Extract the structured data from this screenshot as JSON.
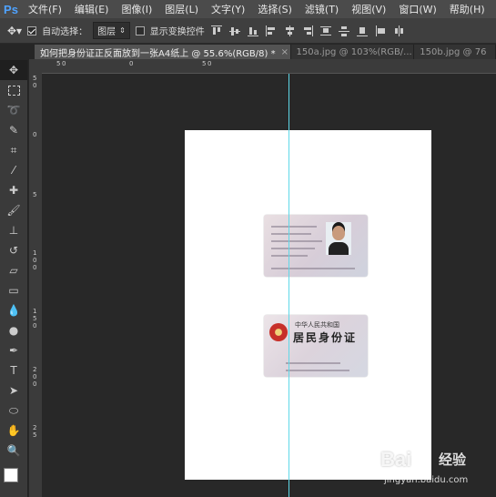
{
  "app": {
    "logo": "Ps"
  },
  "menu": [
    "文件(F)",
    "编辑(E)",
    "图像(I)",
    "图层(L)",
    "文字(Y)",
    "选择(S)",
    "滤镜(T)",
    "视图(V)",
    "窗口(W)",
    "帮助(H)"
  ],
  "options": {
    "auto_select_label": "自动选择：",
    "auto_select_checked": true,
    "layer_select_value": "图层",
    "show_transform_label": "显示变换控件",
    "show_transform_checked": false
  },
  "tabs": [
    {
      "label": "如何把身份证正反面放到一张A4纸上 @ 55.6%(RGB/8) *",
      "close": "×",
      "active": true
    },
    {
      "label": "150a.jpg @ 103%(RGB/...",
      "close": "×",
      "active": false
    },
    {
      "label": "150b.jpg @ 76",
      "close": "",
      "active": false
    }
  ],
  "rulers": {
    "top": [
      "5",
      "0",
      "0",
      "5",
      "0"
    ],
    "left": [
      "5",
      "0",
      "0",
      "5",
      "1",
      "0",
      "0",
      "1",
      "5",
      "0",
      "2",
      "0",
      "0",
      "2",
      "5"
    ]
  },
  "id_card_back": {
    "title": "中华人民共和国",
    "big_text": "居民身份证"
  },
  "watermark": {
    "logo": "Bai",
    "text": "经验",
    "sub": "jingyan.baidu.com"
  },
  "colors": {
    "guide": "#5fd8e8",
    "ps_blue": "#4fa3ff"
  }
}
